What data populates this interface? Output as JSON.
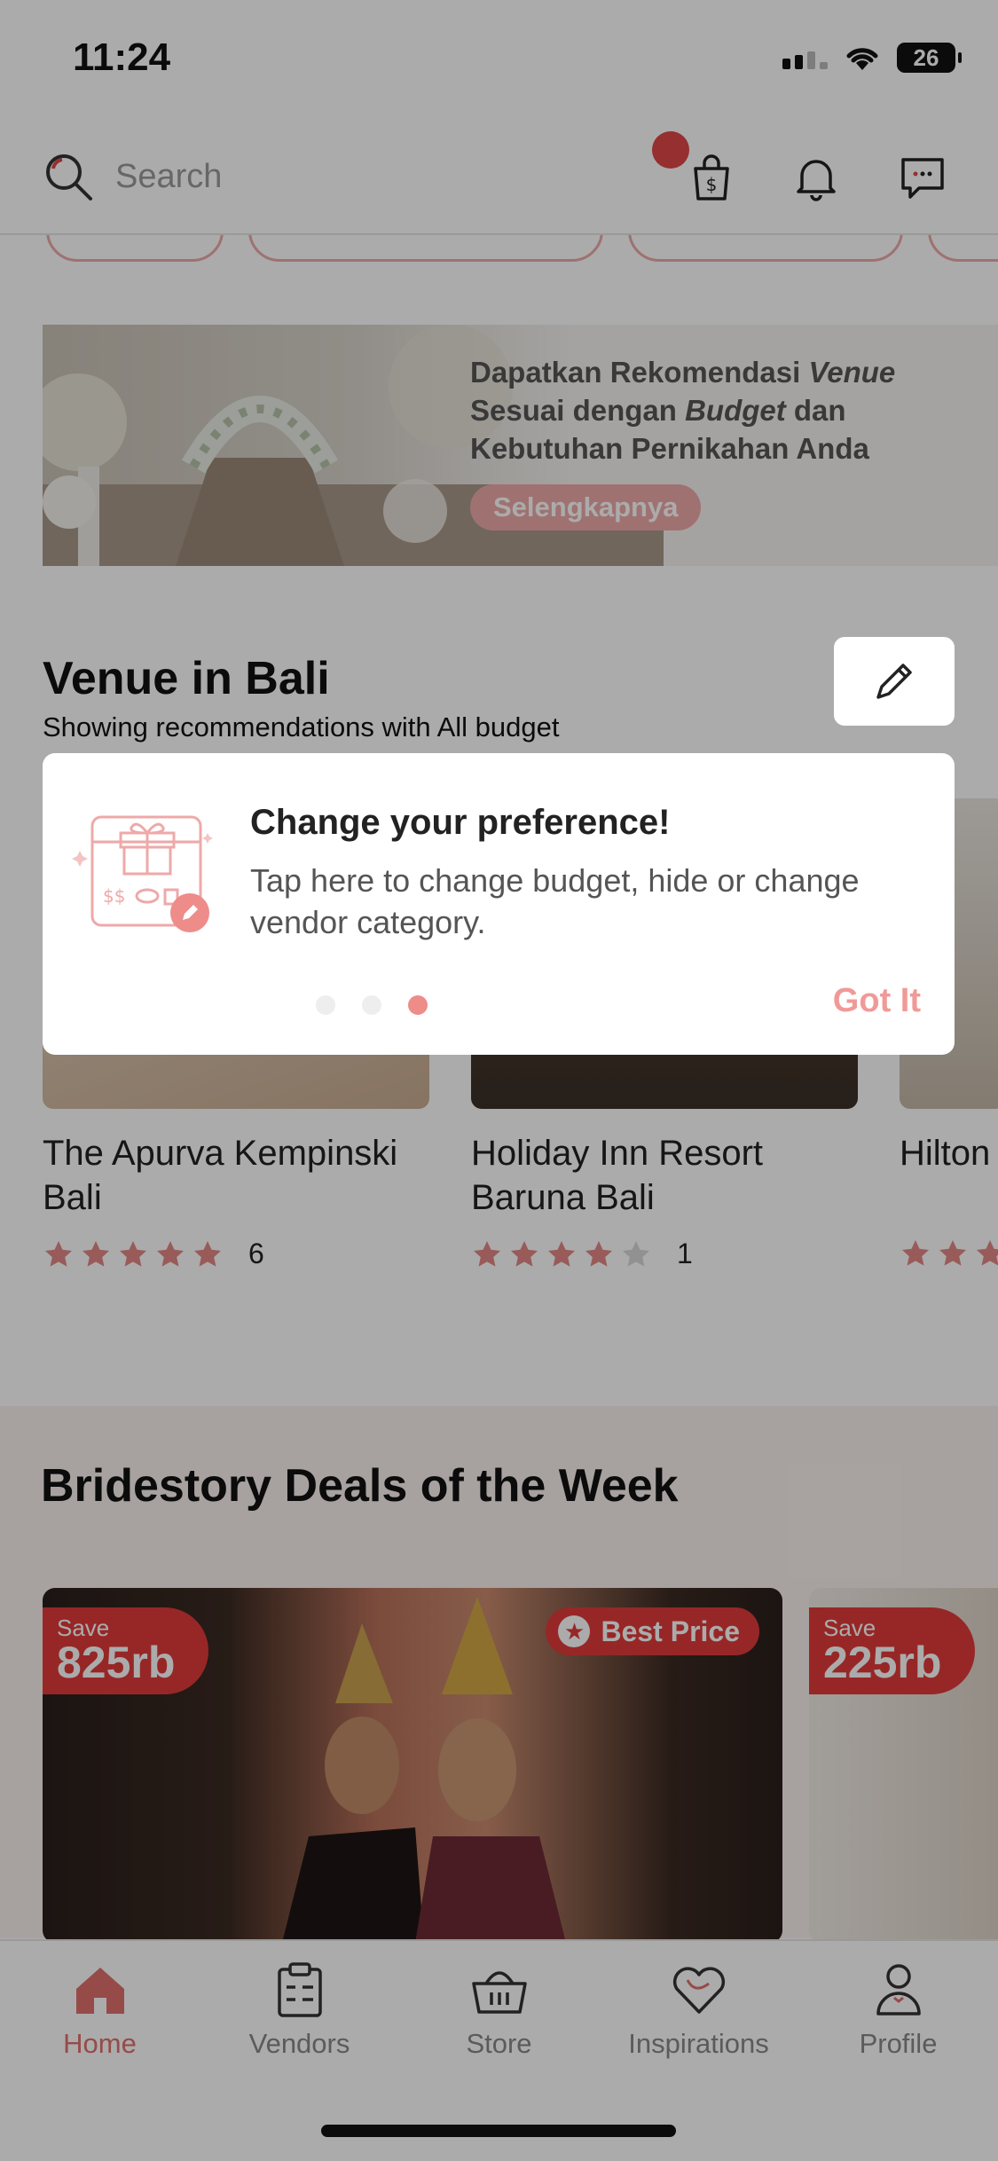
{
  "status_bar": {
    "time": "11:24",
    "battery": "26"
  },
  "search": {
    "placeholder": "Search"
  },
  "banner": {
    "line1": "Dapatkan Rekomendasi ",
    "line1_em": "Venue",
    "line2": "Sesuai dengan ",
    "line2_em": "Budget",
    "line2_end": " dan",
    "line3": "Kebutuhan Pernikahan Anda",
    "button": "Selengkapnya"
  },
  "venue_section": {
    "title": "Venue in Bali",
    "subtitle": "Showing recommendations with All budget",
    "cards": [
      {
        "name": "The Apurva Kempinski Bali",
        "rating": 5,
        "count": "6"
      },
      {
        "name": "Holiday Inn Resort Baruna Bali",
        "rating": 4,
        "count": "1"
      },
      {
        "name": "Hilton",
        "rating": 5,
        "count": ""
      }
    ]
  },
  "tooltip": {
    "title": "Change your preference!",
    "body": "Tap here to change budget, hide or change vendor category.",
    "button": "Got It",
    "pages": 3,
    "active_page": 3
  },
  "deals": {
    "title": "Bridestory Deals of the Week",
    "cards": [
      {
        "save_label": "Save",
        "save_amount": "825rb",
        "badge": "Best Price"
      },
      {
        "save_label": "Save",
        "save_amount": "225rb"
      }
    ]
  },
  "tabs": [
    {
      "label": "Home",
      "active": true
    },
    {
      "label": "Vendors"
    },
    {
      "label": "Store"
    },
    {
      "label": "Inspirations"
    },
    {
      "label": "Profile"
    }
  ],
  "colors": {
    "accent": "#e0706d",
    "deal_red": "#e23b3b",
    "star": "#e38885"
  }
}
